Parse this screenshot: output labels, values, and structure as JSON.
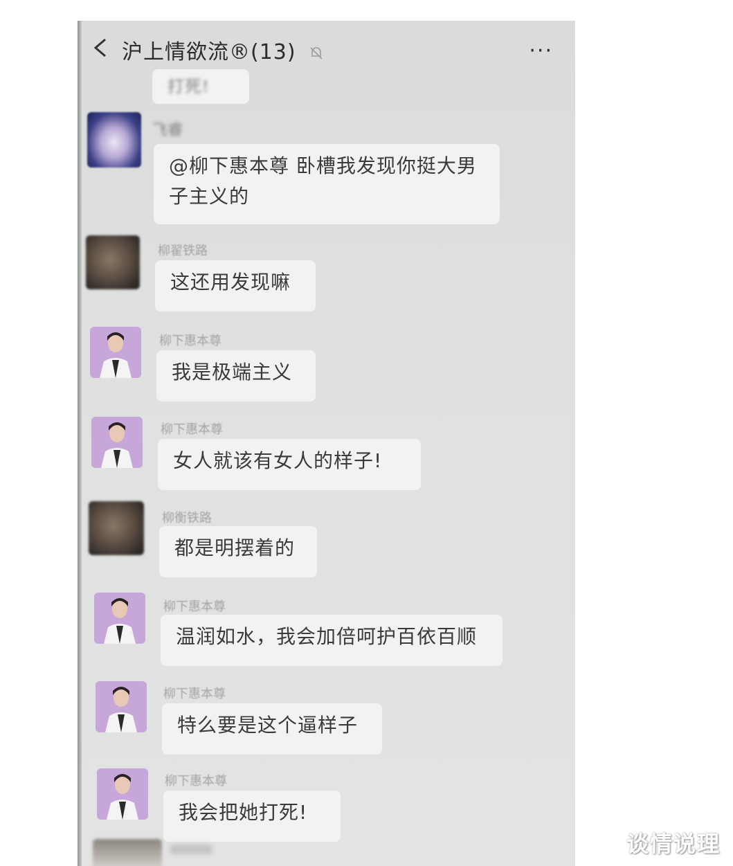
{
  "header": {
    "title": "沪上情欲流®(13)",
    "back_icon": "chevron-left-icon",
    "mute_icon": "bell-muted-icon",
    "more_icon": "more-horizontal-icon",
    "more_label": "···"
  },
  "partial_top": "打死!",
  "messages": [
    {
      "sender": "飞睿",
      "avatar": "blue-cloud",
      "text": "@柳下惠本尊  卧槽我发现你挺大男子主义的"
    },
    {
      "sender": "柳翟铁路",
      "avatar": "dark-blur",
      "text": "这还用发现嘛"
    },
    {
      "sender": "柳下惠本尊",
      "avatar": "purple-portrait",
      "text": "我是极端主义"
    },
    {
      "sender": "柳下惠本尊",
      "avatar": "purple-portrait",
      "text": "女人就该有女人的样子!"
    },
    {
      "sender": "柳衡铁路",
      "avatar": "dark-blur",
      "text": "都是明摆着的"
    },
    {
      "sender": "柳下惠本尊",
      "avatar": "purple-portrait",
      "text": "温润如水，我会加倍呵护百依百顺"
    },
    {
      "sender": "柳下惠本尊",
      "avatar": "purple-portrait",
      "text": "特么要是这个逼样子"
    },
    {
      "sender": "柳下惠本尊",
      "avatar": "purple-portrait",
      "text": "我会把她打死!"
    }
  ],
  "watermark": "谈情说理",
  "colors": {
    "bubble": "#f1f2f1",
    "chat_bg": "#dfe1e0",
    "purple_avatar": "#c7a6da"
  }
}
